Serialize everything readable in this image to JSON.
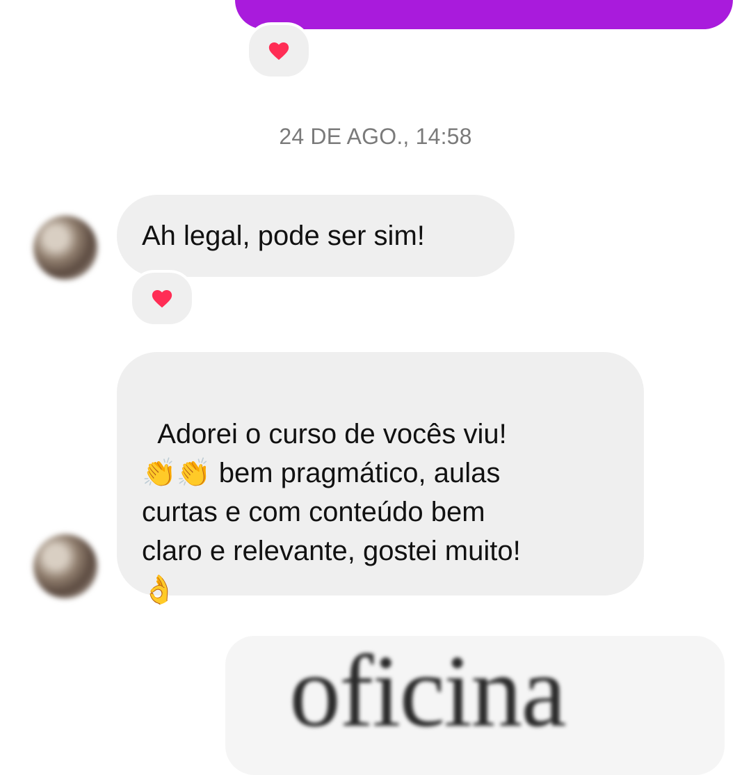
{
  "chat": {
    "sent_message_fragment": "",
    "reaction_top": "heart",
    "timestamp": "24 DE AGO., 14:58",
    "messages": [
      {
        "text": "Ah legal, pode ser sim!",
        "reaction": "heart"
      },
      {
        "text": "Adorei o curso de vocês viu!\n👏👏 bem pragmático, aulas\ncurtas e com conteúdo bem\nclaro e relevante, gostei muito!\n👌"
      }
    ],
    "image_card_text": "oficina"
  },
  "colors": {
    "sent_bubble": "#a91bdc",
    "received_bubble": "#efefef",
    "timestamp": "#7a7a7a",
    "heart": "#ff2d55"
  },
  "icons": {
    "reaction": "heart-icon",
    "avatar": "avatar"
  }
}
